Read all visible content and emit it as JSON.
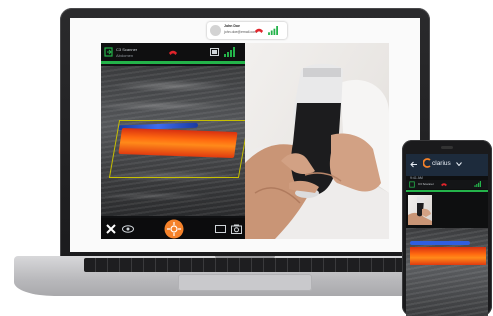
{
  "call": {
    "name": "John Doe",
    "email": "john.doe@email.com"
  },
  "scanner": {
    "device_label": "C3 Scanner",
    "preset_label": "Abdomen",
    "mode_label": "Color"
  },
  "phone": {
    "brand": "clarius",
    "status": "9:41 AM",
    "device_label": "C3 Scanner"
  },
  "colors": {
    "accent_green": "#24b34a",
    "accent_orange": "#f5822a",
    "hangup_red": "#e0242b",
    "doppler_red": "#ff6a10",
    "doppler_blue": "#2f5ee0"
  },
  "icons": {
    "close": "close-icon",
    "eye": "eye-icon",
    "scan_button": "scan-button",
    "monitor": "monitor-icon",
    "camera": "camera-icon",
    "hangup": "hangup-icon",
    "signal": "signal-icon",
    "battery": "battery-icon"
  }
}
